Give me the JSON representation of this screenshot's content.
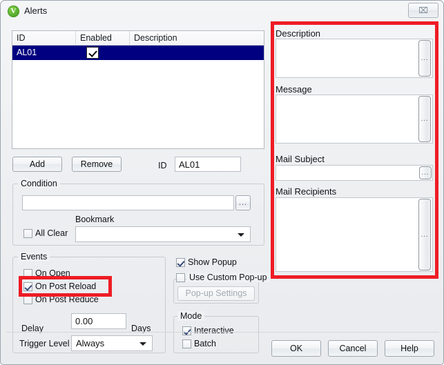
{
  "window": {
    "title": "Alerts",
    "icon": "qlikview-logo-icon",
    "icon_letter": "V",
    "close_label": "⌧",
    "accent_red": "#ee1c25",
    "selection_blue": "#000080"
  },
  "alerts_table": {
    "columns": [
      "ID",
      "Enabled",
      "Description"
    ],
    "rows": [
      {
        "id": "AL01",
        "enabled": true,
        "description": ""
      }
    ]
  },
  "list_buttons": {
    "add": "Add",
    "remove": "Remove"
  },
  "id_field": {
    "label": "ID",
    "value": "AL01"
  },
  "condition": {
    "title": "Condition",
    "expression_value": "",
    "expression_browse": "...",
    "all_clear_label": "All Clear",
    "all_clear_checked": false,
    "bookmark_label": "Bookmark",
    "bookmark_value": ""
  },
  "events": {
    "title": "Events",
    "items": [
      {
        "label": "On Open",
        "checked": false
      },
      {
        "label": "On Post Reload",
        "checked": true
      },
      {
        "label": "On Post Reduce",
        "checked": false
      }
    ],
    "delay_label": "Delay",
    "delay_value": "0.00",
    "delay_unit": "Days",
    "trigger_level_label": "Trigger Level",
    "trigger_level_value": "Always"
  },
  "popup": {
    "show_popup_label": "Show Popup",
    "show_popup_checked": true,
    "use_custom_label": "Use Custom Pop-up",
    "use_custom_checked": false,
    "settings_button": "Pop-up Settings",
    "settings_enabled": false
  },
  "mode": {
    "title": "Mode",
    "items": [
      {
        "label": "Interactive",
        "checked": true
      },
      {
        "label": "Batch",
        "checked": false
      }
    ]
  },
  "right_panel": {
    "description": {
      "label": "Description",
      "value": "",
      "browse": "..."
    },
    "message": {
      "label": "Message",
      "value": "",
      "browse": "..."
    },
    "mail_subject": {
      "label": "Mail Subject",
      "value": "",
      "browse": "..."
    },
    "mail_recipients": {
      "label": "Mail Recipients",
      "value": "",
      "browse": "..."
    }
  },
  "footer": {
    "ok": "OK",
    "cancel": "Cancel",
    "help": "Help"
  }
}
